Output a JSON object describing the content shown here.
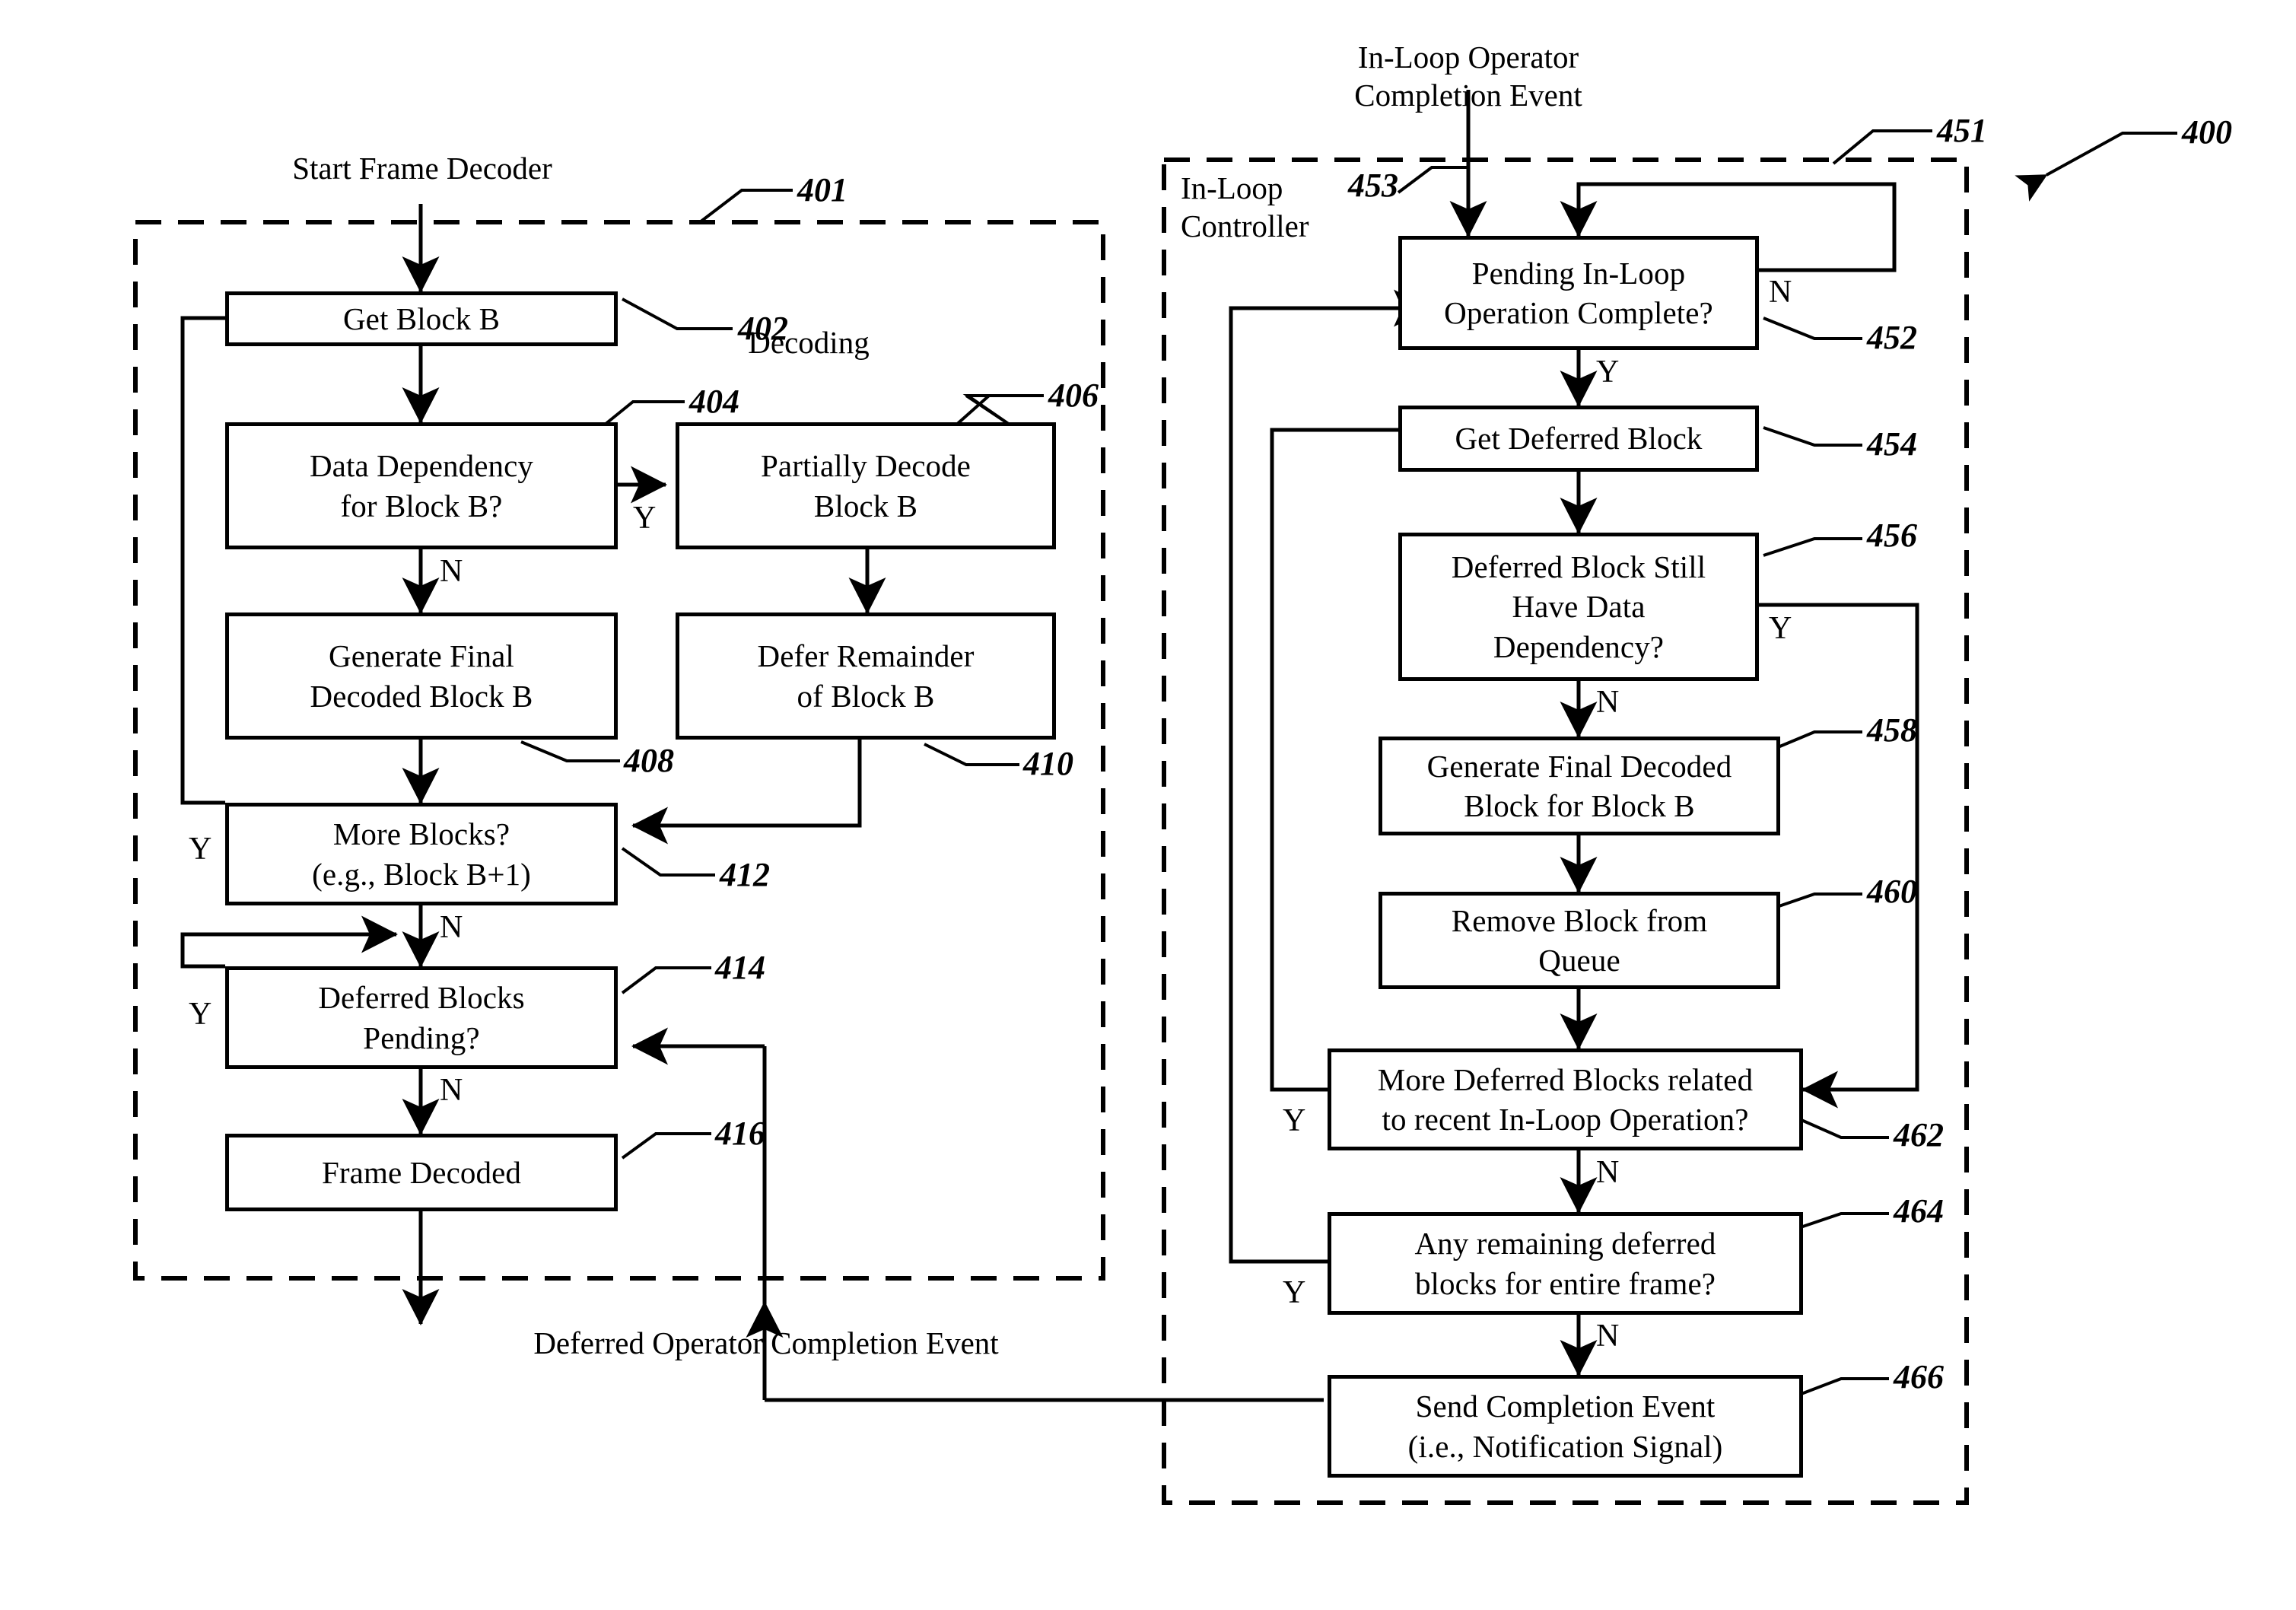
{
  "figure": {
    "figure_number": "400",
    "panels": [
      {
        "id": "decoder-panel",
        "ref": "401",
        "entry_label": "Start Frame Decoder",
        "section_label": "Decoding"
      },
      {
        "id": "inloop-panel",
        "ref": "451",
        "title": "In-Loop\nController",
        "entry_label": "In-Loop Operator\nCompletion Event",
        "entry_ref": "453"
      }
    ],
    "cross_event_label": "Deferred Operator Completion Event"
  },
  "decoder_boxes": [
    {
      "ref": "402",
      "label": "Get Block B"
    },
    {
      "ref": "404",
      "label": "Data Dependency\nfor Block B?"
    },
    {
      "ref": "406",
      "label": "Partially Decode\nBlock B"
    },
    {
      "ref": "408",
      "label": "Generate Final\nDecoded Block B"
    },
    {
      "ref": "410",
      "label": "Defer Remainder\nof Block B"
    },
    {
      "ref": "412",
      "label": "More Blocks?\n(e.g., Block B+1)"
    },
    {
      "ref": "414",
      "label": "Deferred Blocks\nPending?"
    },
    {
      "ref": "416",
      "label": "Frame Decoded"
    }
  ],
  "inloop_boxes": [
    {
      "ref": "452",
      "label": "Pending In-Loop\nOperation Complete?"
    },
    {
      "ref": "454",
      "label": "Get Deferred Block"
    },
    {
      "ref": "456",
      "label": "Deferred Block Still\nHave Data\nDependency?"
    },
    {
      "ref": "458",
      "label": "Generate Final Decoded\nBlock for Block B"
    },
    {
      "ref": "460",
      "label": "Remove Block from\nQueue"
    },
    {
      "ref": "462",
      "label": "More Deferred Blocks related\nto recent In-Loop Operation?"
    },
    {
      "ref": "464",
      "label": "Any remaining deferred\nblocks for entire frame?"
    },
    {
      "ref": "466",
      "label": "Send Completion Event\n(i.e., Notification Signal)"
    }
  ],
  "branch_labels": {
    "b404_yes": "Y",
    "b404_no": "N",
    "b412_yes": "Y",
    "b412_no": "N",
    "b414_yes": "Y",
    "b414_no": "N",
    "b452_no": "N",
    "b452_yes": "Y",
    "b456_yes": "Y",
    "b456_no": "N",
    "b462_yes": "Y",
    "b462_no": "N",
    "b464_yes": "Y",
    "b464_no": "N"
  },
  "colors": {
    "line": "#000000",
    "background": "#ffffff"
  }
}
